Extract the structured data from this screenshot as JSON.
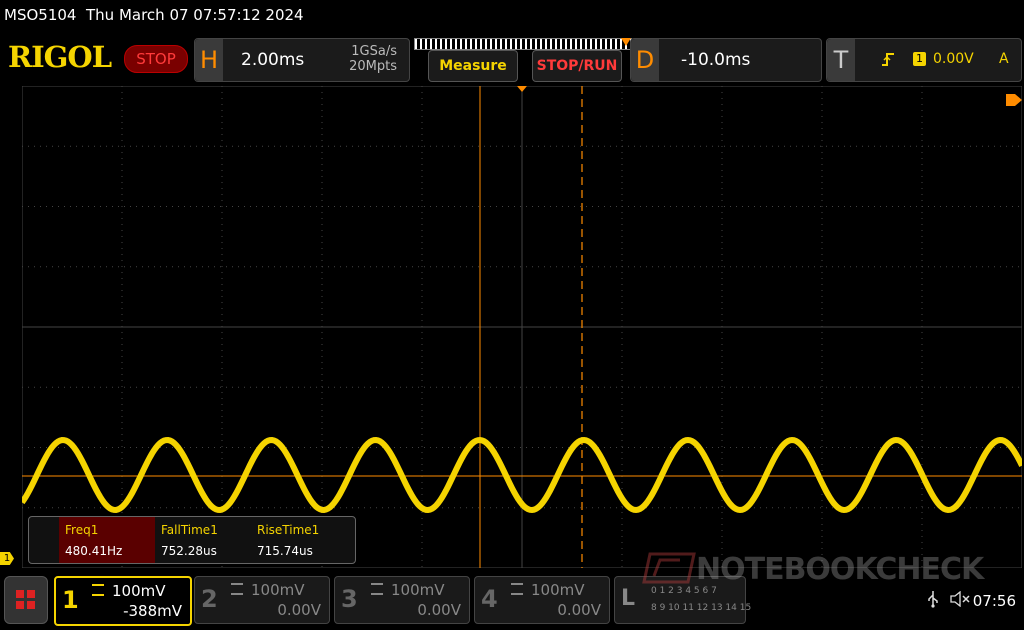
{
  "titlebar": {
    "model": "MSO5104",
    "datetime": "Thu March 07 07:57:12 2024"
  },
  "brand": {
    "logo": "RIGOL",
    "status": "STOP"
  },
  "horizontal": {
    "letter": "H",
    "timebase": "2.00ms",
    "sample_rate": "1GSa/s",
    "memory_depth": "20Mpts"
  },
  "buttons": {
    "measure": "Measure",
    "stop_run": "STOP/RUN"
  },
  "delay": {
    "letter": "D",
    "value": "-10.0ms"
  },
  "trigger": {
    "letter": "T",
    "source": "1",
    "level": "0.00V",
    "mode": "A"
  },
  "waveform": {
    "channel": "1",
    "marker": "1",
    "color": "#f5d400",
    "frequency_hz": 480.41,
    "cycles_visible": 9.6
  },
  "measurements": [
    {
      "name": "Freq1",
      "value": "480.41Hz"
    },
    {
      "name": "FallTime1",
      "value": "752.28us"
    },
    {
      "name": "RiseTime1",
      "value": "715.74us"
    }
  ],
  "channels": [
    {
      "num": "1",
      "scale": "100mV",
      "offset": "-388mV",
      "active": true
    },
    {
      "num": "2",
      "scale": "100mV",
      "offset": "0.00V",
      "active": false
    },
    {
      "num": "3",
      "scale": "100mV",
      "offset": "0.00V",
      "active": false
    },
    {
      "num": "4",
      "scale": "100mV",
      "offset": "0.00V",
      "active": false
    }
  ],
  "logic": {
    "letter": "L",
    "row1": "0 1 2 3 4 5 6 7",
    "row2": "8 9 10 11 12 13 14 15"
  },
  "watermark": "NOTEBOOKCHECK",
  "clock": "07:56",
  "colors": {
    "accent": "#ff8c00",
    "channel1": "#f5d400",
    "stop": "#ff3a3a"
  }
}
